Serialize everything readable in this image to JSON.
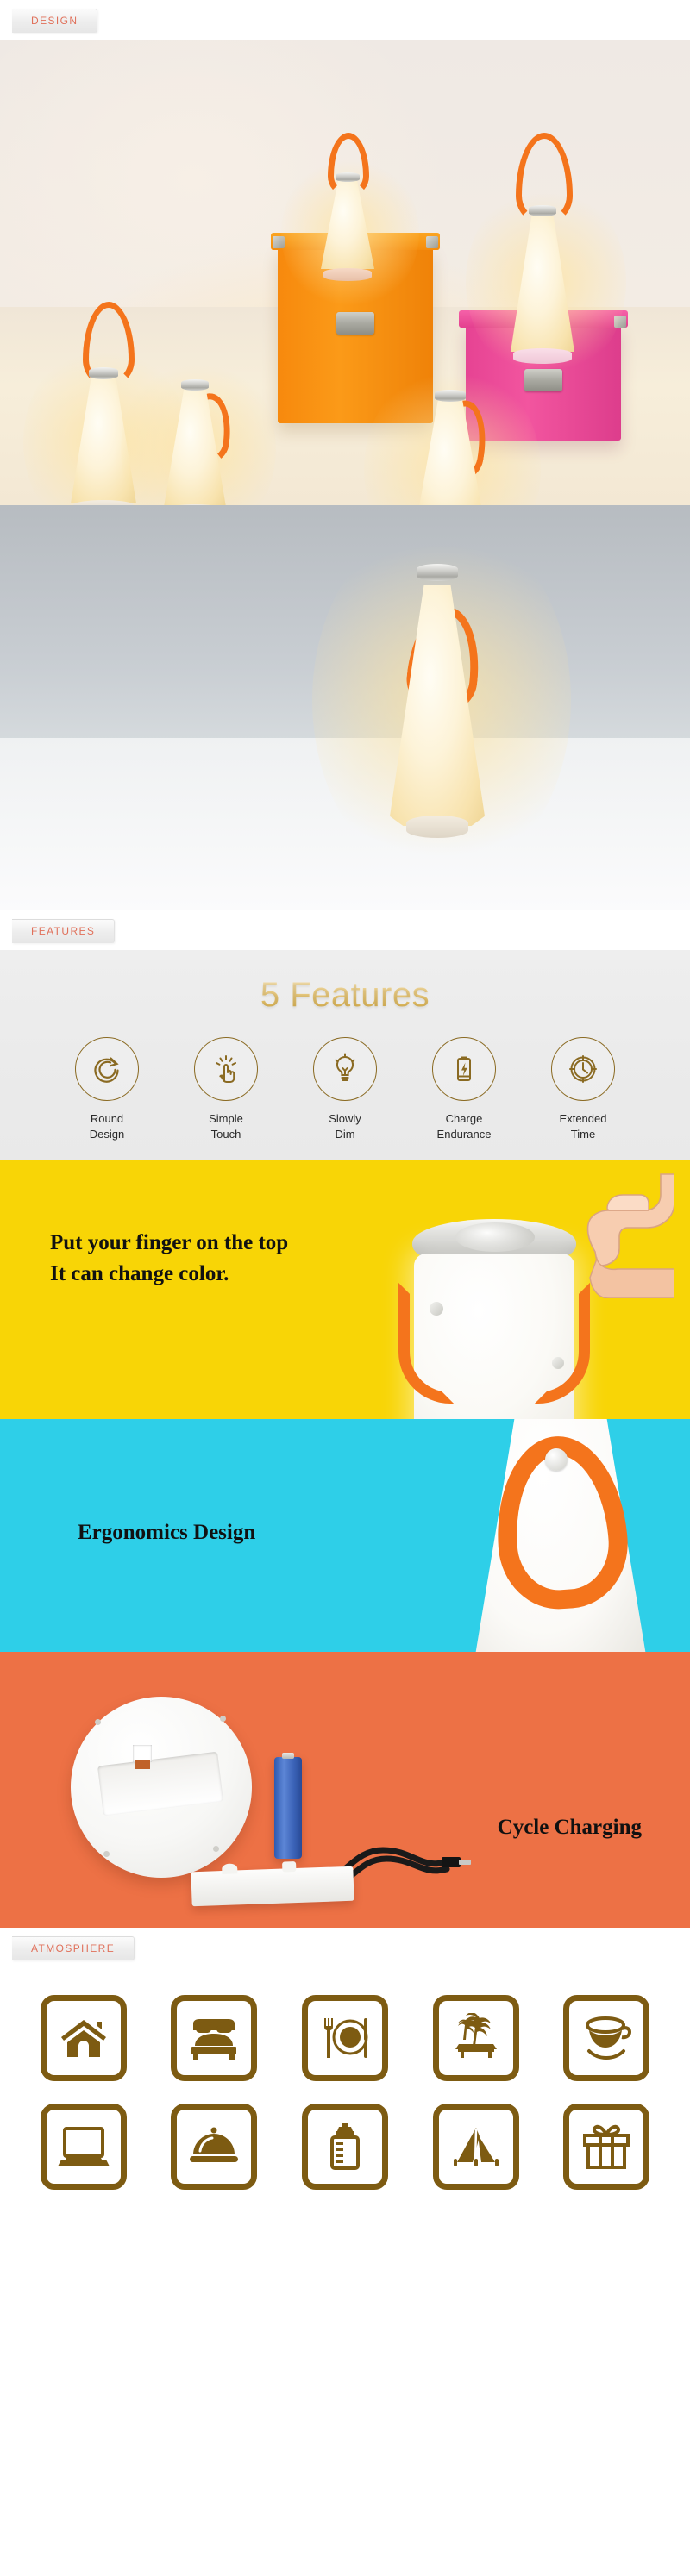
{
  "sections": {
    "design": {
      "tab_label": "DESIGN"
    },
    "features": {
      "tab_label": "FEATURES",
      "title": "5 Features",
      "items": [
        {
          "icon": "circular-arrow-icon",
          "line1": "Round",
          "line2": "Design"
        },
        {
          "icon": "touch-finger-icon",
          "line1": "Simple",
          "line2": "Touch"
        },
        {
          "icon": "light-bulb-icon",
          "line1": "Slowly",
          "line2": "Dim"
        },
        {
          "icon": "battery-charge-icon",
          "line1": "Charge",
          "line2": "Endurance"
        },
        {
          "icon": "clock-icon",
          "line1": "Extended",
          "line2": "Time"
        }
      ]
    },
    "atmosphere": {
      "tab_label": "ATMOSPHERE",
      "icons": [
        {
          "name": "house-icon"
        },
        {
          "name": "bed-icon"
        },
        {
          "name": "dining-plate-fork-icon"
        },
        {
          "name": "palm-beach-hammock-icon"
        },
        {
          "name": "coffee-cup-icon"
        },
        {
          "name": "laptop-icon"
        },
        {
          "name": "food-cloche-icon"
        },
        {
          "name": "baby-bottle-icon"
        },
        {
          "name": "tent-icon"
        },
        {
          "name": "gift-box-icon"
        }
      ]
    }
  },
  "banners": [
    {
      "id": "touch-color",
      "background": "#f8d506",
      "headline_line1": "Put your finger on the top",
      "headline_line2": "It can change color."
    },
    {
      "id": "ergonomics",
      "background": "#2ecfe8",
      "headline_line1": "Ergonomics Design"
    },
    {
      "id": "cycle-charging",
      "background": "#ed7145",
      "headline_line1": "Cycle Charging"
    }
  ],
  "colors": {
    "tab_text": "#e0705a",
    "icon_brown": "#7d5b12",
    "feature_ring": "#8a6a22",
    "gold_title": "#cfa63f",
    "strap_orange": "#f4741c",
    "box_orange": "#f7890d",
    "box_pink": "#e64393"
  }
}
